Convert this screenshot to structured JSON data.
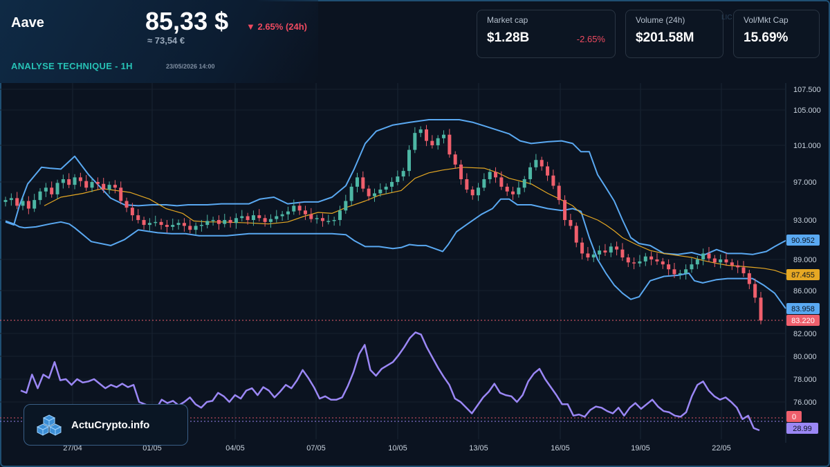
{
  "header": {
    "asset_name": "Aave",
    "price": "85,33 $",
    "price_eur": "≈ 73,54 €",
    "change": "▼ 2.65% (24h)",
    "section_title": "ANALYSE TECHNIQUE - 1H",
    "timestamp": "23/05/2026 14:00"
  },
  "stats": [
    {
      "label": "Market cap",
      "value": "$1.28B",
      "delta": "-2.65%"
    },
    {
      "label": "Volume (24h)",
      "value": "$201.58M",
      "delta": ""
    },
    {
      "label": "Vol/Mkt Cap",
      "value": "15.69%",
      "delta": ""
    }
  ],
  "ghost_text": "LIC",
  "brand": {
    "name": "ActuCrypto.info",
    "logo_icon": "cubes-logo-icon"
  },
  "colors": {
    "up": "#4db6a4",
    "down": "#ef5f6c",
    "bands": "#5aa9f2",
    "ma": "#e6a823",
    "rsi": "#9b87f5",
    "accent": "#27c2b6",
    "negative": "#ef4a60"
  },
  "chart_data": {
    "type": "candlestick",
    "title": "",
    "x_ticks": [
      "27/04",
      "01/05",
      "04/05",
      "07/05",
      "10/05",
      "13/05",
      "16/05",
      "19/05",
      "22/05"
    ],
    "y_ticks": [
      "107.500",
      "105.000",
      "101.000",
      "97.000",
      "93.000",
      "89.000",
      "86.000",
      "82.000",
      "80.000",
      "78.000",
      "76.000"
    ],
    "price_labels": [
      {
        "name": "upper_band",
        "value": 90.952,
        "text": "90.952"
      },
      {
        "name": "ma",
        "value": 87.455,
        "text": "87.455"
      },
      {
        "name": "lower_band",
        "value": 83.958,
        "text": "83.958"
      },
      {
        "name": "last_price",
        "value": 83.22,
        "text": "83.220"
      }
    ],
    "rsi_labels": [
      "0",
      "28.99"
    ],
    "price_series": [
      95.1,
      95.3,
      94.5,
      95.0,
      94.2,
      95.1,
      96.0,
      96.4,
      95.7,
      96.9,
      97.3,
      96.7,
      97.5,
      97.1,
      96.4,
      97.0,
      96.8,
      96.2,
      96.7,
      96.4,
      95.0,
      94.3,
      93.5,
      93.0,
      92.5,
      92.7,
      92.8,
      92.5,
      92.3,
      92.5,
      92.7,
      92.4,
      92.0,
      92.4,
      92.5,
      92.9,
      93.0,
      92.6,
      93.0,
      92.7,
      93.2,
      93.4,
      93.0,
      93.5,
      93.2,
      92.8,
      93.1,
      93.4,
      93.6,
      93.9,
      94.5,
      94.0,
      93.6,
      93.1,
      93.2,
      92.9,
      92.9,
      93.0,
      94.0,
      95.0,
      96.5,
      97.5,
      96.3,
      95.5,
      95.8,
      96.2,
      96.5,
      97.0,
      97.6,
      98.2,
      100.5,
      102.4,
      102.8,
      101.5,
      101.0,
      101.8,
      102.2,
      100.0,
      98.9,
      97.3,
      96.2,
      95.6,
      96.4,
      97.3,
      98.1,
      97.5,
      96.5,
      96.0,
      95.7,
      96.4,
      97.3,
      98.6,
      99.4,
      98.7,
      97.7,
      96.6,
      95.1,
      93.0,
      92.4,
      90.7,
      89.6,
      89.2,
      89.5,
      89.9,
      89.7,
      90.3,
      90.0,
      89.2,
      88.7,
      88.6,
      88.8,
      89.3,
      89.0,
      88.8,
      88.5,
      88.0,
      87.5,
      87.6,
      88.0,
      88.5,
      89.0,
      89.6,
      89.1,
      88.7,
      89.0,
      88.7,
      88.4,
      88.2,
      87.6,
      86.6,
      85.2,
      83.2
    ],
    "upper_band_pts": [
      [
        0,
        92.8
      ],
      [
        6,
        92.5
      ],
      [
        10,
        94.5
      ],
      [
        16,
        96.8
      ],
      [
        26,
        98.6
      ],
      [
        32,
        98.5
      ],
      [
        40,
        98.4
      ],
      [
        50,
        99.8
      ],
      [
        60,
        97.8
      ],
      [
        76,
        95.3
      ],
      [
        86,
        94.6
      ],
      [
        96,
        94.5
      ],
      [
        106,
        94.6
      ],
      [
        116,
        94.6
      ],
      [
        124,
        94.5
      ],
      [
        132,
        94.6
      ],
      [
        146,
        94.6
      ],
      [
        156,
        94.7
      ],
      [
        166,
        94.7
      ],
      [
        176,
        94.7
      ],
      [
        184,
        95.2
      ],
      [
        194,
        95.4
      ],
      [
        204,
        94.7
      ],
      [
        216,
        94.9
      ],
      [
        226,
        94.9
      ],
      [
        236,
        95.4
      ],
      [
        246,
        96.6
      ],
      [
        252,
        98.4
      ],
      [
        260,
        101.2
      ],
      [
        268,
        102.6
      ],
      [
        280,
        103.3
      ],
      [
        292,
        103.6
      ],
      [
        306,
        103.9
      ],
      [
        318,
        103.9
      ],
      [
        328,
        103.9
      ],
      [
        338,
        103.6
      ],
      [
        346,
        103.2
      ],
      [
        356,
        102.7
      ],
      [
        364,
        102.3
      ],
      [
        372,
        101.5
      ],
      [
        380,
        101.2
      ],
      [
        392,
        101.4
      ],
      [
        402,
        101.5
      ],
      [
        410,
        101.2
      ],
      [
        416,
        100.3
      ],
      [
        422,
        100.3
      ],
      [
        428,
        97.8
      ],
      [
        434,
        96.4
      ],
      [
        440,
        95.0
      ],
      [
        446,
        93.0
      ],
      [
        452,
        91.2
      ],
      [
        458,
        90.6
      ],
      [
        466,
        90.4
      ],
      [
        476,
        89.6
      ],
      [
        486,
        89.5
      ],
      [
        496,
        89.7
      ],
      [
        504,
        89.4
      ],
      [
        514,
        90.0
      ],
      [
        522,
        89.6
      ],
      [
        532,
        89.6
      ],
      [
        540,
        89.5
      ],
      [
        550,
        89.8
      ],
      [
        556,
        90.3
      ],
      [
        560,
        90.6
      ],
      [
        564,
        90.9
      ]
    ],
    "lower_band_pts": [
      [
        0,
        92.9
      ],
      [
        6,
        92.6
      ],
      [
        10,
        92.3
      ],
      [
        14,
        92.2
      ],
      [
        22,
        92.3
      ],
      [
        32,
        92.6
      ],
      [
        40,
        92.8
      ],
      [
        46,
        92.6
      ],
      [
        50,
        92.2
      ],
      [
        56,
        91.5
      ],
      [
        62,
        90.8
      ],
      [
        76,
        90.4
      ],
      [
        86,
        91.0
      ],
      [
        96,
        92.0
      ],
      [
        110,
        91.7
      ],
      [
        120,
        91.6
      ],
      [
        130,
        91.6
      ],
      [
        140,
        91.4
      ],
      [
        150,
        91.4
      ],
      [
        160,
        91.4
      ],
      [
        176,
        91.6
      ],
      [
        190,
        91.6
      ],
      [
        204,
        91.6
      ],
      [
        216,
        91.6
      ],
      [
        226,
        91.6
      ],
      [
        236,
        91.6
      ],
      [
        246,
        91.5
      ],
      [
        252,
        90.9
      ],
      [
        260,
        90.3
      ],
      [
        270,
        90.3
      ],
      [
        280,
        90.1
      ],
      [
        286,
        90.2
      ],
      [
        292,
        90.5
      ],
      [
        298,
        90.4
      ],
      [
        304,
        90.4
      ],
      [
        310,
        90.1
      ],
      [
        316,
        89.8
      ],
      [
        320,
        90.5
      ],
      [
        326,
        91.8
      ],
      [
        334,
        92.6
      ],
      [
        344,
        93.6
      ],
      [
        352,
        94.2
      ],
      [
        358,
        95.2
      ],
      [
        364,
        95.2
      ],
      [
        370,
        94.6
      ],
      [
        380,
        94.6
      ],
      [
        392,
        94.2
      ],
      [
        402,
        94.0
      ],
      [
        410,
        94.2
      ],
      [
        416,
        93.9
      ],
      [
        422,
        91.2
      ],
      [
        428,
        89.0
      ],
      [
        434,
        87.6
      ],
      [
        440,
        86.5
      ],
      [
        446,
        85.7
      ],
      [
        452,
        85.0
      ],
      [
        458,
        85.3
      ],
      [
        466,
        86.9
      ],
      [
        476,
        87.3
      ],
      [
        486,
        87.4
      ],
      [
        494,
        87.6
      ],
      [
        498,
        86.9
      ],
      [
        504,
        86.7
      ],
      [
        514,
        87.0
      ],
      [
        522,
        87.1
      ],
      [
        532,
        87.1
      ],
      [
        540,
        87.1
      ],
      [
        548,
        86.5
      ],
      [
        556,
        85.7
      ],
      [
        562,
        84.4
      ],
      [
        564,
        83.958
      ]
    ],
    "ma_pts": [
      [
        28,
        94.5
      ],
      [
        40,
        95.4
      ],
      [
        56,
        95.8
      ],
      [
        70,
        96.3
      ],
      [
        80,
        96.1
      ],
      [
        90,
        95.9
      ],
      [
        104,
        95.2
      ],
      [
        116,
        94.2
      ],
      [
        128,
        93.7
      ],
      [
        136,
        92.9
      ],
      [
        146,
        92.8
      ],
      [
        156,
        92.8
      ],
      [
        176,
        92.7
      ],
      [
        190,
        92.6
      ],
      [
        204,
        92.8
      ],
      [
        216,
        93.4
      ],
      [
        226,
        93.8
      ],
      [
        236,
        93.7
      ],
      [
        246,
        94.3
      ],
      [
        260,
        95.0
      ],
      [
        270,
        95.6
      ],
      [
        286,
        96.1
      ],
      [
        296,
        97.4
      ],
      [
        306,
        98.0
      ],
      [
        316,
        98.3
      ],
      [
        330,
        98.6
      ],
      [
        346,
        98.5
      ],
      [
        356,
        98.0
      ],
      [
        364,
        97.4
      ],
      [
        372,
        97.1
      ],
      [
        380,
        96.8
      ],
      [
        392,
        95.8
      ],
      [
        402,
        95.1
      ],
      [
        410,
        94.5
      ],
      [
        416,
        93.7
      ],
      [
        428,
        93.0
      ],
      [
        434,
        92.5
      ],
      [
        440,
        91.9
      ],
      [
        446,
        91.2
      ],
      [
        456,
        90.5
      ],
      [
        466,
        89.9
      ],
      [
        476,
        89.6
      ],
      [
        486,
        89.4
      ],
      [
        496,
        89.2
      ],
      [
        504,
        88.9
      ],
      [
        514,
        88.6
      ],
      [
        522,
        88.4
      ],
      [
        532,
        88.3
      ],
      [
        540,
        88.2
      ],
      [
        548,
        88.1
      ],
      [
        556,
        87.9
      ],
      [
        562,
        87.6
      ],
      [
        566,
        87.455
      ]
    ],
    "rsi": [
      77.0,
      76.8,
      78.4,
      77.2,
      78.4,
      78.1,
      79.5,
      77.9,
      78.0,
      77.5,
      78.0,
      77.7,
      77.8,
      78.0,
      77.6,
      77.2,
      77.5,
      77.3,
      77.6,
      77.3,
      77.5,
      76.0,
      75.8,
      75.6,
      75.4,
      76.2,
      75.9,
      76.1,
      75.7,
      76.0,
      76.4,
      75.8,
      75.5,
      76.0,
      76.1,
      76.8,
      76.5,
      76.0,
      76.6,
      76.3,
      77.0,
      77.2,
      76.6,
      77.3,
      77.0,
      76.4,
      76.9,
      77.5,
      77.2,
      77.9,
      78.8,
      78.1,
      77.3,
      76.3,
      76.5,
      76.2,
      76.2,
      76.4,
      77.4,
      78.6,
      80.2,
      81.0,
      78.8,
      78.3,
      78.9,
      79.2,
      79.5,
      80.1,
      80.8,
      81.6,
      82.1,
      81.9,
      80.8,
      79.9,
      79.0,
      78.2,
      77.5,
      76.3,
      76.0,
      75.5,
      75.0,
      75.7,
      76.4,
      76.9,
      77.6,
      76.8,
      76.6,
      76.5,
      76.0,
      76.6,
      77.8,
      78.5,
      78.9,
      78.0,
      77.3,
      76.6,
      75.8,
      75.8,
      74.8,
      74.9,
      74.7,
      75.3,
      75.6,
      75.5,
      75.2,
      75.0,
      75.5,
      74.8,
      75.5,
      75.9,
      75.4,
      75.8,
      76.2,
      75.6,
      75.2,
      75.1,
      74.8,
      74.7,
      75.1,
      76.5,
      77.5,
      77.8,
      77.0,
      76.5,
      76.2,
      76.4,
      76.0,
      75.5,
      74.5,
      74.8,
      73.7,
      73.5
    ]
  }
}
